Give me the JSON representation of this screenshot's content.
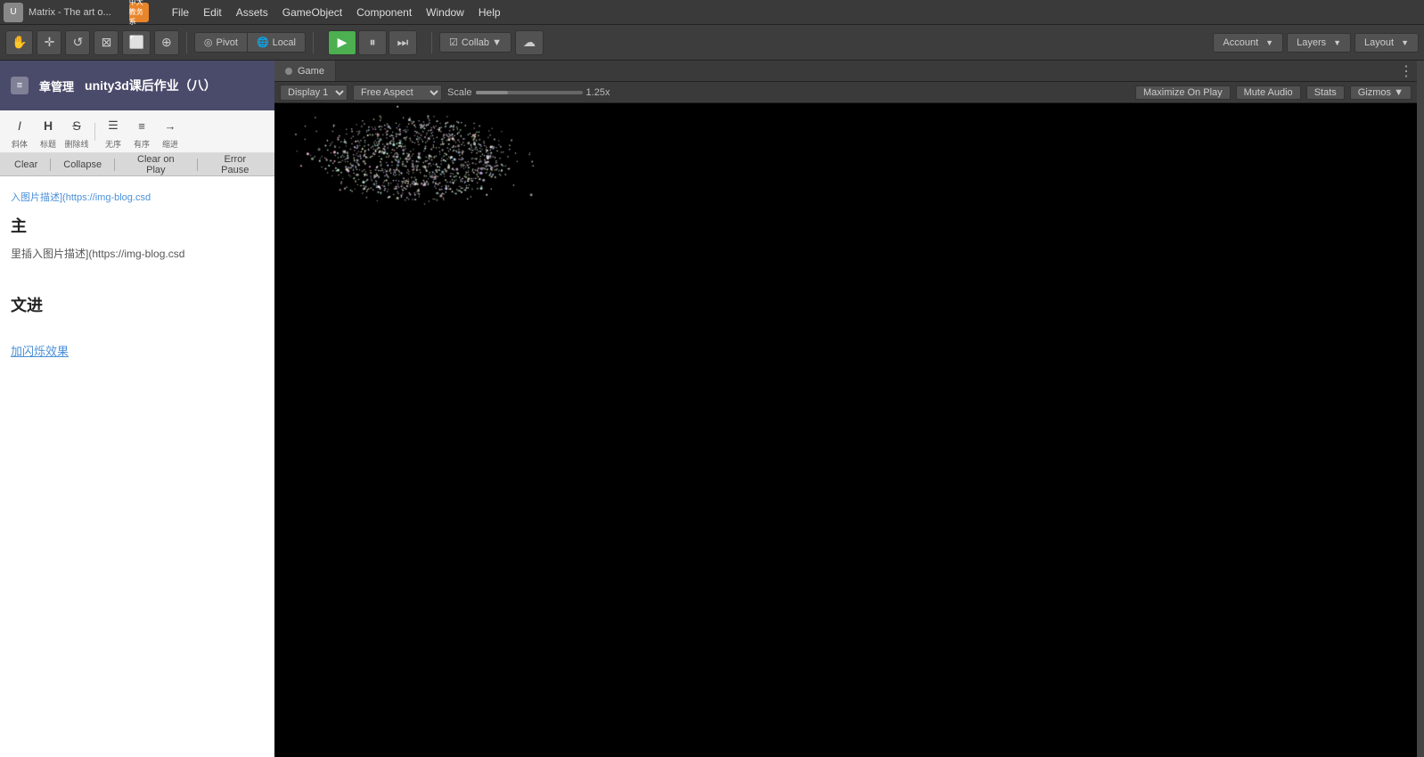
{
  "app": {
    "icon": "U",
    "title": "Matrix - The art o...",
    "edu_label": "中大教务系"
  },
  "menu": {
    "items": [
      "File",
      "Edit",
      "Assets",
      "GameObject",
      "Component",
      "Window",
      "Help"
    ]
  },
  "toolbar": {
    "hand_icon": "✋",
    "move_icon": "✛",
    "rotate_icon": "↺",
    "scale_icon": "⊠",
    "rect_icon": "⬜",
    "transform_icon": "⊕",
    "pivot_label": "Pivot",
    "local_label": "Local",
    "play_icon": "▶",
    "pause_icon": "⏸",
    "step_icon": "⏭",
    "collab_label": "Collab ▼",
    "cloud_icon": "☁",
    "account_label": "Account",
    "layers_label": "Layers",
    "layout_label": "Layout"
  },
  "left_panel": {
    "top_icon": "≡",
    "chapter_label": "章管理",
    "doc_title": "unity3d课后作业（八）"
  },
  "format_toolbar": {
    "italic_icon": "I",
    "italic_label": "斜体",
    "bold_icon": "H",
    "bold_label": "标题",
    "strike_icon": "S",
    "strike_label": "删除线",
    "ul_icon": "≡",
    "ul_label": "无序",
    "ol_icon": "≡",
    "ol_label": "有序",
    "indent_icon": "→",
    "indent_label": "缩进"
  },
  "console": {
    "clear_label": "Clear",
    "collapse_label": "Collapse",
    "clear_on_play_label": "Clear on Play",
    "error_pause_label": "Error Pause"
  },
  "editor_content": {
    "image_placeholder_1": "入图片描述](https://img-blog.csd",
    "heading_1": "主",
    "body_text_1": "里插入图片描述](https://img-blog.csd",
    "heading_2": "文进",
    "link_text": "加闪烁效果"
  },
  "game_view": {
    "tab_label": "Game",
    "display_label": "Display 1",
    "aspect_label": "Free Aspect",
    "scale_label": "Scale",
    "scale_value": "1.25x",
    "maximize_label": "Maximize On Play",
    "mute_label": "Mute Audio",
    "stats_label": "Stats",
    "gizmos_label": "Gizmos"
  },
  "colors": {
    "bg_dark": "#000000",
    "toolbar_bg": "#3d3d3d",
    "panel_bg": "#494949",
    "unity_blue": "#4a90d9",
    "left_bg": "#f0f0f0"
  }
}
